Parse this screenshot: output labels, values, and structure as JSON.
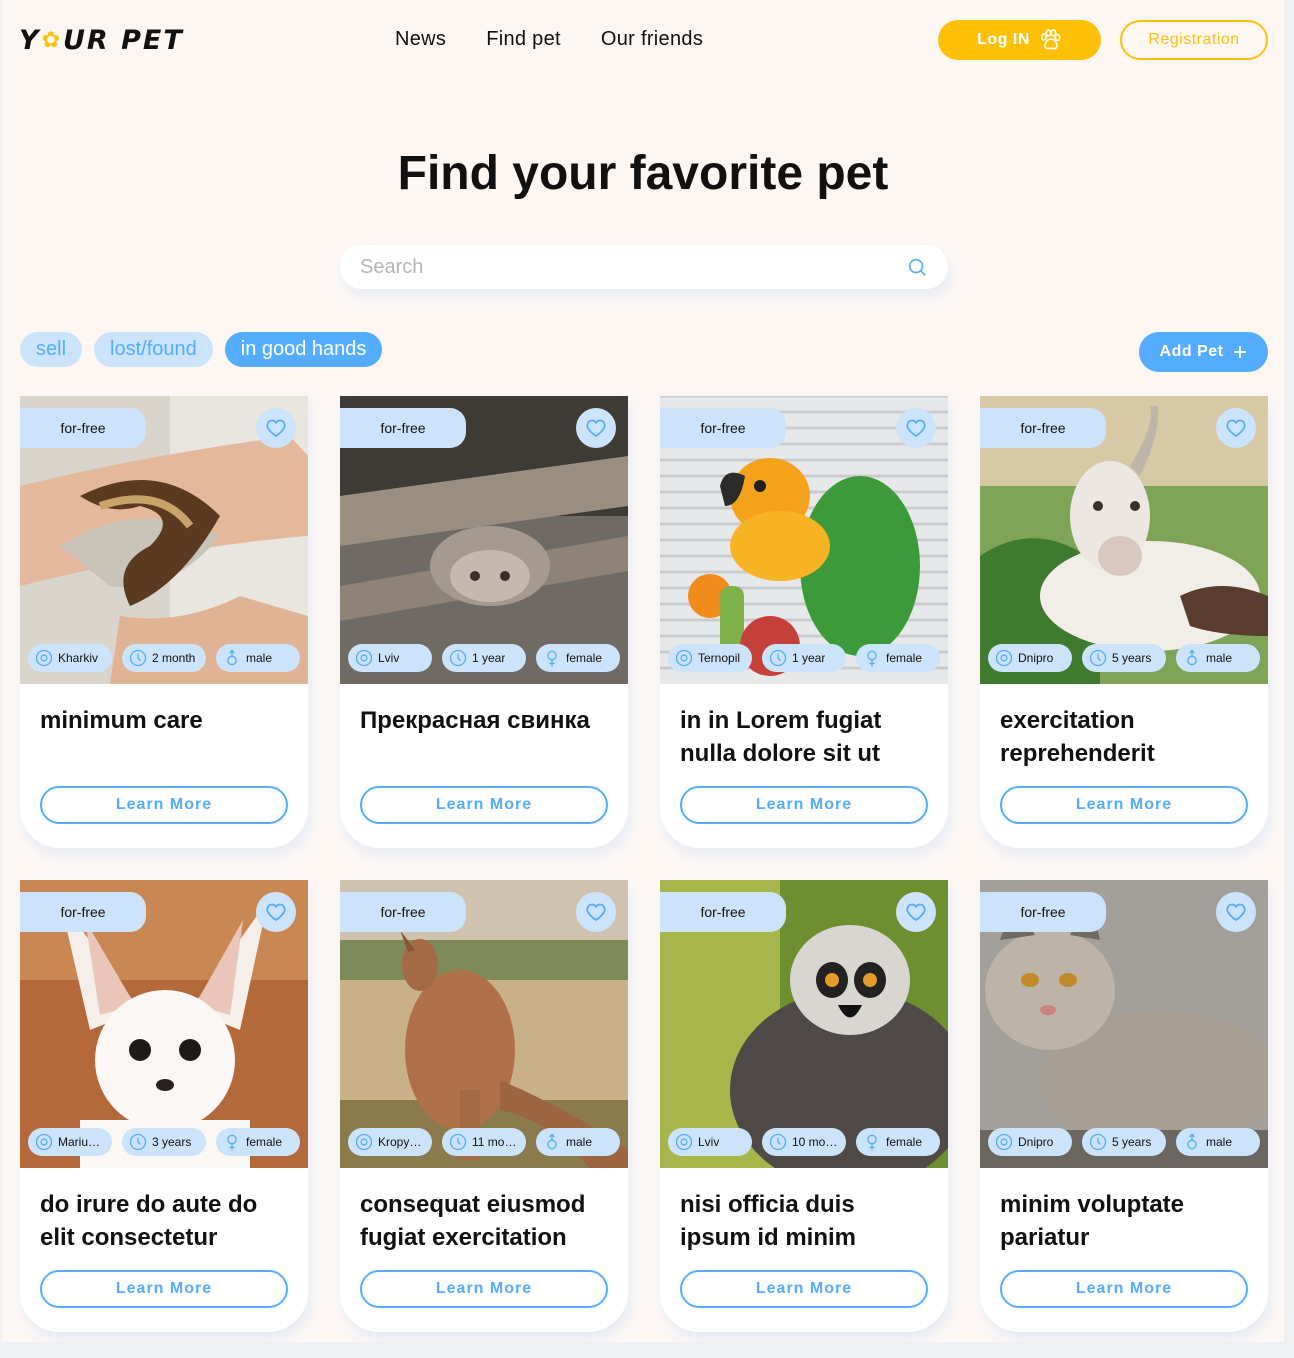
{
  "header": {
    "logo_text": "YOUR PET",
    "nav": [
      "News",
      "Find pet",
      "Our friends"
    ],
    "login_label": "Log IN",
    "register_label": "Registration"
  },
  "main": {
    "title": "Find your favorite pet",
    "search_placeholder": "Search",
    "filters": [
      {
        "label": "sell",
        "active": false
      },
      {
        "label": "lost/found",
        "active": false
      },
      {
        "label": "in good hands",
        "active": true
      }
    ],
    "add_pet_label": "Add Pet"
  },
  "colors": {
    "accent_yellow": "#ffc107",
    "accent_blue": "#54adff",
    "light_blue": "#cce4fb",
    "bg": "#fdf7f4"
  },
  "cards": [
    {
      "tag": "for-free",
      "location": "Kharkiv",
      "age": "2 month",
      "sex": "male",
      "title": "minimum care",
      "button": "Learn More",
      "photo": "snake"
    },
    {
      "tag": "for-free",
      "location": "Lviv",
      "age": "1 year",
      "sex": "female",
      "title": "Прекрасная свинка",
      "button": "Learn More",
      "photo": "pig"
    },
    {
      "tag": "for-free",
      "location": "Ternopil",
      "age": "1 year",
      "sex": "female",
      "title": "in in Lorem fugiat nulla dolore sit ut",
      "button": "Learn More",
      "photo": "parrot"
    },
    {
      "tag": "for-free",
      "location": "Dnipro",
      "age": "5 years",
      "sex": "male",
      "title": "exercitation reprehenderit",
      "button": "Learn More",
      "photo": "goat"
    },
    {
      "tag": "for-free",
      "location": "Mariup…",
      "age": "3 years",
      "sex": "female",
      "title": "do irure do aute do elit consectetur",
      "button": "Learn More",
      "photo": "fox"
    },
    {
      "tag": "for-free",
      "location": "Kropyv…",
      "age": "11 mon…",
      "sex": "male",
      "title": "consequat eiusmod fugiat exercitation",
      "button": "Learn More",
      "photo": "kangaroo"
    },
    {
      "tag": "for-free",
      "location": "Lviv",
      "age": "10 mon…",
      "sex": "female",
      "title": "nisi officia duis ipsum id minim",
      "button": "Learn More",
      "photo": "lemur"
    },
    {
      "tag": "for-free",
      "location": "Dnipro",
      "age": "5 years",
      "sex": "male",
      "title": "minim voluptate pariatur",
      "button": "Learn More",
      "photo": "lynx"
    }
  ]
}
